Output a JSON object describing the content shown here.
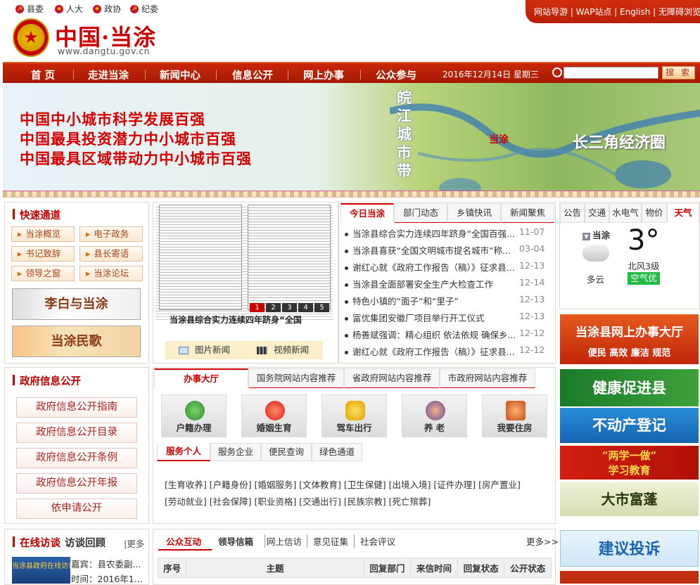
{
  "top": {
    "party_links": [
      "县委",
      "人大",
      "政协",
      "纪委"
    ],
    "quick_links": "网站导游 | WAP站点 | English | 无障碍浏览"
  },
  "logo": {
    "title": "中国·当涂",
    "url": "www.dangtu.gov.cn"
  },
  "nav": {
    "items": [
      "首 页",
      "走进当涂",
      "新闻中心",
      "信息公开",
      "网上办事",
      "公众参与"
    ],
    "date": "2016年12月14日 星期三",
    "search_placeholder": "",
    "search_label": "搜 索"
  },
  "banner": {
    "slogans": [
      "中国中小城市科学发展百强",
      "中国最具投资潜力中小城市百强",
      "中国最具区域带动力中小城市百强"
    ],
    "map_labels": {
      "city_belt": "皖江城市带",
      "dangtu": "当涂",
      "yrd": "长三角经济圈"
    }
  },
  "quick_channel": {
    "title": "快速通道",
    "buttons": [
      "当涂概览",
      "电子政务",
      "书记致辞",
      "县长寄语",
      "领导之窗",
      "当涂论坛"
    ],
    "image_links": [
      "李白与当涂",
      "当涂民歌"
    ]
  },
  "photo_news": {
    "pages": [
      "1",
      "2",
      "3",
      "4",
      "5"
    ],
    "caption": "当涂县综合实力连续四年跻身“全国",
    "buttons": [
      "图片新闻",
      "视频新闻"
    ]
  },
  "news": {
    "tabs": [
      "今日当涂",
      "部门动态",
      "乡镇快讯",
      "新闻聚焦"
    ],
    "items": [
      {
        "title": "当涂县综合实力连续四年跻身“全国百强...",
        "date": "11-07"
      },
      {
        "title": "当涂县喜获“全国文明城市提名城市”称...",
        "date": "03-04"
      },
      {
        "title": "谢红心就《政府工作报告（稿）》征求县...",
        "date": "12-13"
      },
      {
        "title": "当涂县全面部署安全生产大检查工作",
        "date": "12-14"
      },
      {
        "title": "特色小镇的“面子”和“里子”",
        "date": "12-13"
      },
      {
        "title": "富优集团安徽厂项目举行开工仪式",
        "date": "12-13"
      },
      {
        "title": "杨善斌强调：精心组织 依法依规 确保乡...",
        "date": "12-12"
      },
      {
        "title": "谢红心就《政府工作报告（稿）》征求县...",
        "date": "12-12"
      }
    ]
  },
  "weather": {
    "tabs": [
      "公告",
      "交通",
      "水电气",
      "物价",
      "天气"
    ],
    "city": "当涂",
    "temp": "3°",
    "wind": "北风3级",
    "desc": "多云",
    "air": "空气优"
  },
  "right_banners": {
    "online": "当涂县网上办事大厅",
    "online_sub": "便民 高效 廉洁 规范",
    "health": "健康促进县",
    "estate": "不动产登记",
    "study1": "“两学一做”",
    "study2": "学习教育",
    "fudang": "大市富蓬",
    "advice": "建议投诉"
  },
  "gov_info": {
    "title": "政府信息公开",
    "buttons": [
      "政府信息公开指南",
      "政府信息公开目录",
      "政府信息公开条例",
      "政府信息公开年报",
      "依申请公开"
    ]
  },
  "service": {
    "tabs": [
      "办事大厅",
      "国务院网站内容推荐",
      "省政府网站内容推荐",
      "市政府网站内容推荐"
    ],
    "icons": [
      "户籍办理",
      "婚姻生育",
      "驾车出行",
      "养 老",
      "我要住房"
    ],
    "subtabs": [
      "服务个人",
      "服务企业",
      "便民查询",
      "绿色通道"
    ],
    "links_row1": "[生育收养] [户籍身份] [婚姻服务] [文体教育] [卫生保健] [出境入境] [证件办理] [房产置业]",
    "links_row2": "[劳动就业] [社会保障] [职业资格] [交通出行] [民族宗教] [死亡殡葬]"
  },
  "interview": {
    "title": "在线访谈",
    "title2": "访谈回顾",
    "more": "|更多",
    "img_text": "当涂县政府在线访谈",
    "guest": "嘉宾：县农委副...",
    "time": "时间：2016年1..."
  },
  "interaction": {
    "tabs": [
      "公众互动",
      "领导信箱",
      "网上信访",
      "意见征集",
      "社会评议"
    ],
    "more": "更多>>",
    "headers": [
      "序号",
      "主题",
      "回复部门",
      "来信时间",
      "回复状态",
      "公开状态"
    ]
  },
  "colors": {
    "brand_red": "#c00",
    "nav_red": "#b71f05"
  }
}
